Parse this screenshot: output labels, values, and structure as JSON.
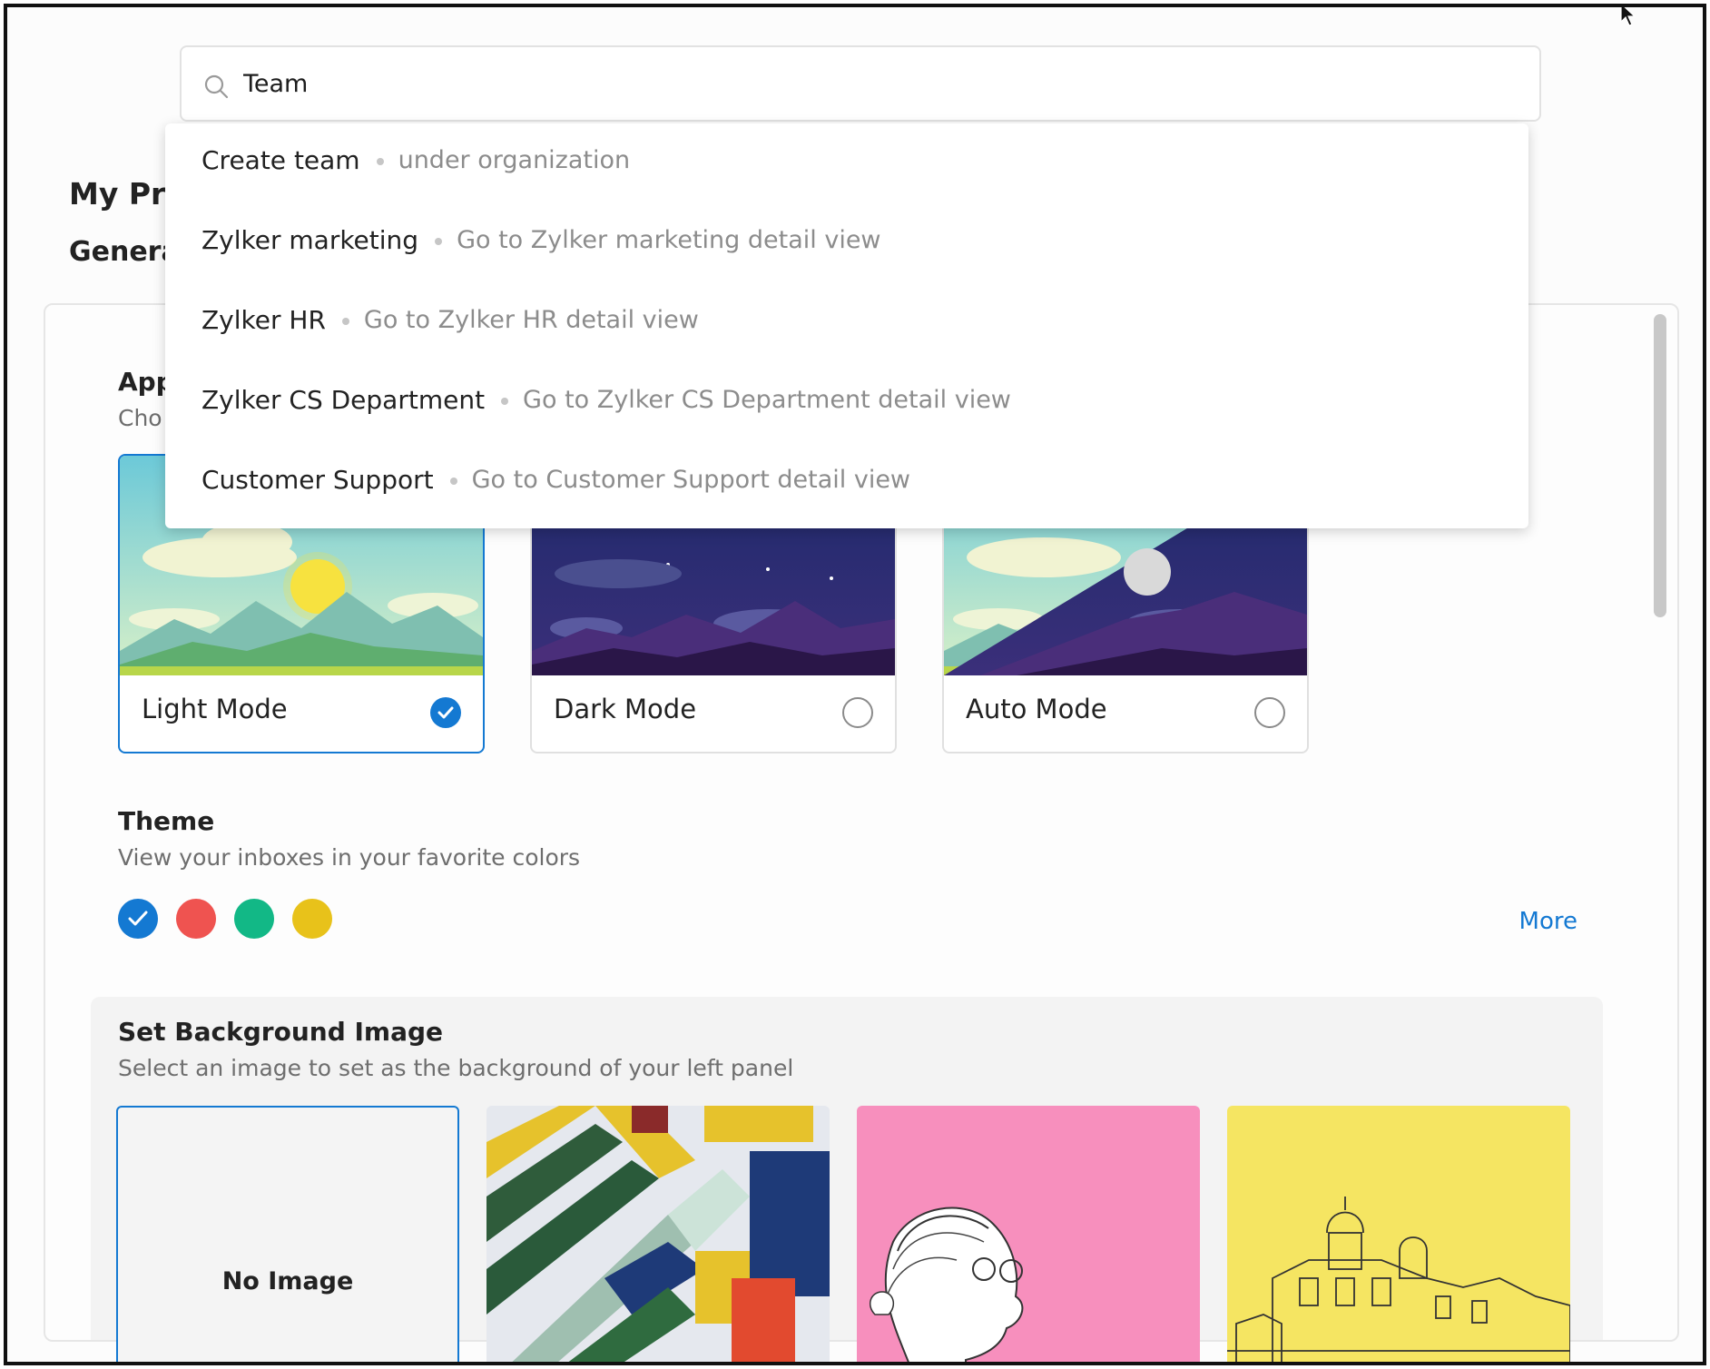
{
  "search": {
    "value": "Team",
    "icon": "search-icon"
  },
  "dropdown": {
    "items": [
      {
        "title": "Create team",
        "subtitle": "under organization"
      },
      {
        "title": "Zylker marketing",
        "subtitle": "Go to Zylker marketing detail view"
      },
      {
        "title": "Zylker HR",
        "subtitle": "Go to Zylker HR detail view"
      },
      {
        "title": "Zylker CS Department",
        "subtitle": "Go to Zylker CS Department detail view"
      },
      {
        "title": "Customer Support",
        "subtitle": "Go to Customer Support detail view"
      }
    ]
  },
  "page": {
    "title_visible": "My Pro",
    "subtitle_visible": "Genera"
  },
  "appearance": {
    "title_visible": "App",
    "desc_visible": "Cho",
    "modes": [
      {
        "label": "Light Mode",
        "selected": true
      },
      {
        "label": "Dark Mode",
        "selected": false
      },
      {
        "label": "Auto Mode",
        "selected": false
      }
    ]
  },
  "theme": {
    "title": "Theme",
    "description": "View your inboxes in your favorite colors",
    "colors": [
      "#1479d2",
      "#ef5350",
      "#12b886",
      "#e8c21a"
    ],
    "selected_index": 0,
    "more_label": "More"
  },
  "background": {
    "title": "Set Background Image",
    "description": "Select an image to set as the background of your left panel",
    "no_image_label": "No Image",
    "selected": "No Image"
  },
  "colors": {
    "accent": "#1479d2",
    "border": "#e0e0e0",
    "muted_text": "#8c8c8c"
  }
}
